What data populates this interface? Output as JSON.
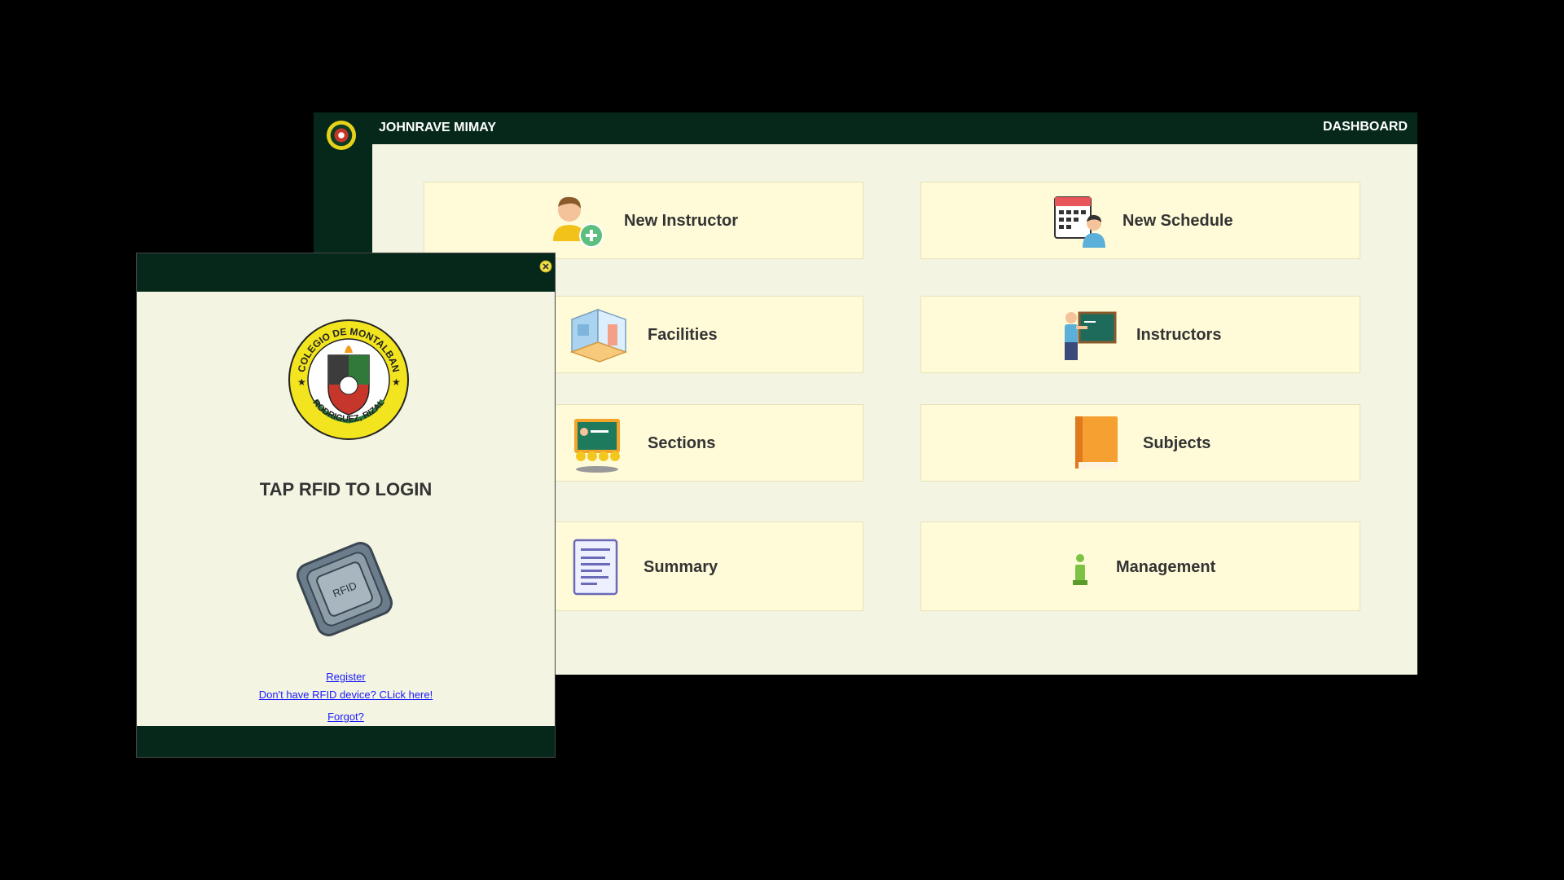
{
  "dashboard": {
    "user_name": "JOHNRAVE MIMAY",
    "title": "DASHBOARD",
    "cards": [
      {
        "label": "New Instructor",
        "icon": "new-instructor-icon"
      },
      {
        "label": "New Schedule",
        "icon": "new-schedule-icon"
      },
      {
        "label": "Facilities",
        "icon": "facilities-icon"
      },
      {
        "label": "Instructors",
        "icon": "instructors-icon"
      },
      {
        "label": "Sections",
        "icon": "sections-icon"
      },
      {
        "label": "Subjects",
        "icon": "subjects-icon"
      },
      {
        "label": "Summary",
        "icon": "summary-icon"
      },
      {
        "label": "Management",
        "icon": "management-icon"
      }
    ]
  },
  "login": {
    "heading": "TAP RFID TO LOGIN",
    "logo": {
      "top_text": "COLEGIO DE MONTALBAN",
      "bottom_text": "RODRIGUEZ, RIZAL"
    },
    "rfid_label": "RFID",
    "links": {
      "register": "Register",
      "no_device": "Don't have RFID device? CLick here!",
      "forgot": "Forgot?"
    }
  },
  "colors": {
    "header_bg": "#06281b",
    "content_bg": "#f3f4e1",
    "card_bg": "#fffbd8",
    "link": "#1a1aff"
  }
}
